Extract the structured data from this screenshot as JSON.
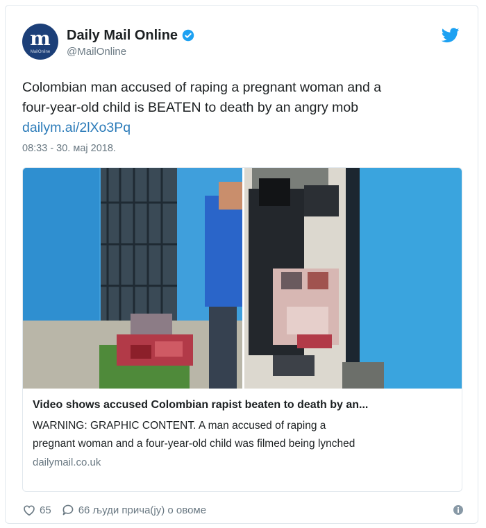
{
  "tweet": {
    "author": {
      "name": "Daily Mail Online",
      "handle": "@MailOnline",
      "avatar_letter": "m",
      "avatar_sub": "MailOnline",
      "verified": true
    },
    "text_line1": "Colombian man accused of raping a pregnant woman and a",
    "text_line2": "four-year-old child is BEATEN to death by an angry mob",
    "link": "dailym.ai/2lXo3Pq",
    "timestamp": "08:33 - 30. мај 2018.",
    "card": {
      "title": "Video shows accused Colombian rapist beaten to death by an...",
      "description_line1": "WARNING: GRAPHIC CONTENT. A man accused of raping a",
      "description_line2": "pregnant woman and a four-year-old child was filmed being lynched",
      "domain": "dailymail.co.uk"
    },
    "footer": {
      "likes": "65",
      "talking": "66 људи прича(ју) о овоме"
    },
    "colors": {
      "link": "#2b7bb9",
      "twitter_blue": "#1da1f2",
      "muted": "#697882",
      "avatar_bg": "#1c3f78"
    },
    "icons": [
      "verified-badge-icon",
      "twitter-bird-icon",
      "heart-icon",
      "comment-bubble-icon",
      "info-icon"
    ]
  }
}
